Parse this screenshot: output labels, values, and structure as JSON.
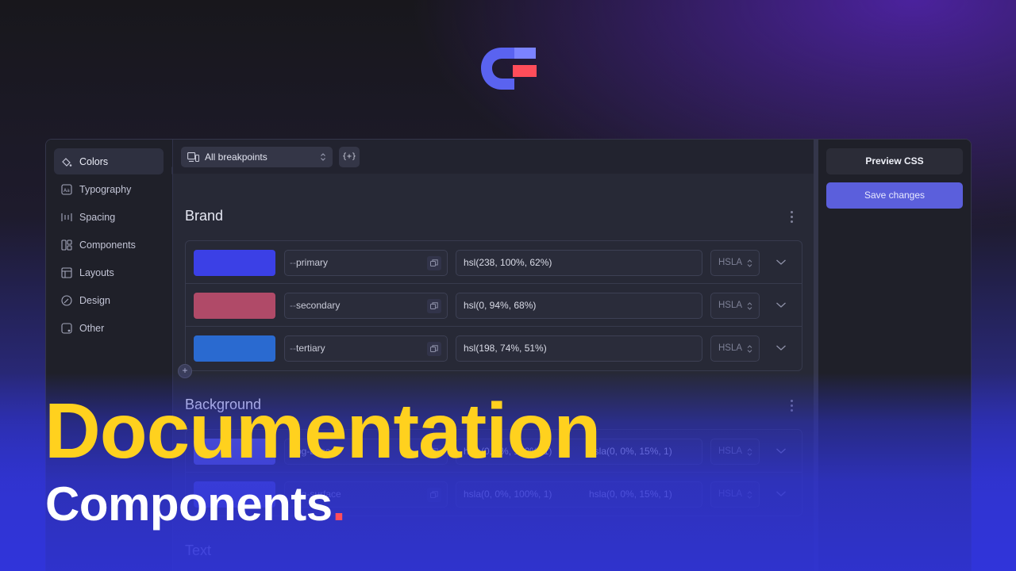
{
  "sidebar": {
    "items": [
      {
        "label": "Colors",
        "icon": "paint-bucket-icon",
        "active": true
      },
      {
        "label": "Typography",
        "icon": "typography-icon"
      },
      {
        "label": "Spacing",
        "icon": "spacing-icon"
      },
      {
        "label": "Components",
        "icon": "components-icon"
      },
      {
        "label": "Layouts",
        "icon": "layout-icon"
      },
      {
        "label": "Design",
        "icon": "design-icon"
      },
      {
        "label": "Other",
        "icon": "other-icon"
      }
    ]
  },
  "toolbar": {
    "breakpoint_label": "All breakpoints",
    "variable_button": "{+}"
  },
  "brand": {
    "title": "Brand",
    "rows": [
      {
        "name": "primary",
        "value": "hsl(238, 100%, 62%)",
        "format": "HSLA",
        "color": "#3b40e6"
      },
      {
        "name": "secondary",
        "value": "hsl(0, 94%, 68%)",
        "format": "HSLA",
        "color": "#b04a68"
      },
      {
        "name": "tertiary",
        "value": "hsl(198, 74%, 51%)",
        "format": "HSLA",
        "color": "#2a6ad0"
      }
    ]
  },
  "background": {
    "title": "Background",
    "rows": [
      {
        "name": "bg-base",
        "value": "hsla(0, 0%, 100%, 1)",
        "value2": "hsla(0, 0%, 15%, 1)",
        "format": "HSLA",
        "color": "#6c6fd8"
      },
      {
        "name": "bg-surface",
        "value": "hsla(0, 0%, 100%, 1)",
        "value2": "hsla(0, 0%, 15%, 1)",
        "format": "HSLA",
        "color": "#5a5ed5"
      }
    ]
  },
  "text_section": {
    "title": "Text"
  },
  "actions": {
    "preview_label": "Preview CSS",
    "save_label": "Save changes"
  },
  "overlay": {
    "headline": "Documentation",
    "subline": "Components",
    "dot": "."
  },
  "colors": {
    "accent_yellow": "#ffd11e",
    "save_button": "#5b5fdc",
    "logo_blue": "#5a63f0",
    "logo_red": "#ff4d5a"
  }
}
